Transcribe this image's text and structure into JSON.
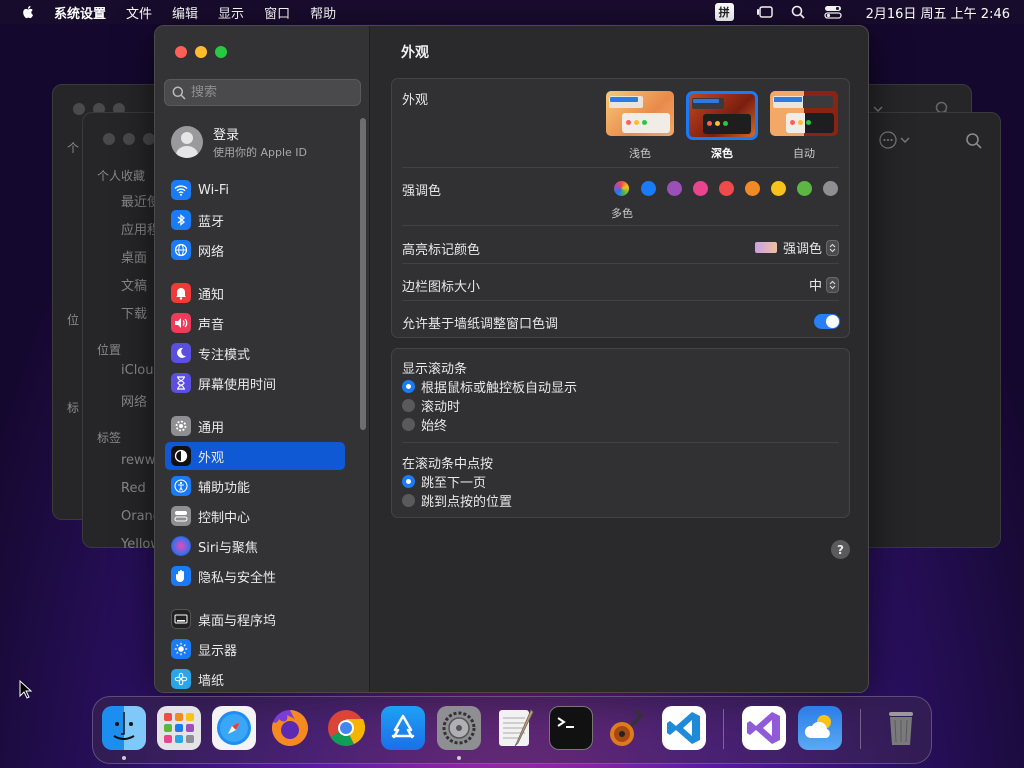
{
  "menubar": {
    "app": "系统设置",
    "items": [
      "文件",
      "编辑",
      "显示",
      "窗口",
      "帮助"
    ],
    "ime": "拼",
    "clock": "2月16日 周五 上午 2:46"
  },
  "finder": {
    "groups": [
      "个人收藏",
      "位置",
      "标签"
    ],
    "favorites": [
      "最近使",
      "应用程",
      "桌面",
      "文稿",
      "下载"
    ],
    "locations": [
      "iClou",
      "网络"
    ],
    "tags": [
      "rewwr",
      "Red",
      "Orang",
      "Yellow"
    ],
    "left_labels": [
      "个",
      "位",
      "标"
    ]
  },
  "sidebar": {
    "search_placeholder": "搜索",
    "login_title": "登录",
    "login_sub": "使用你的 Apple ID",
    "items": [
      {
        "label": "Wi-Fi",
        "icon": "wifi-icon",
        "color": "#1a7bf6"
      },
      {
        "label": "蓝牙",
        "icon": "bluetooth-icon",
        "color": "#1a7bf6"
      },
      {
        "label": "网络",
        "icon": "globe-icon",
        "color": "#1a7bf6"
      },
      {
        "label": "通知",
        "icon": "bell-icon",
        "color": "#ee3b37"
      },
      {
        "label": "声音",
        "icon": "speaker-icon",
        "color": "#ee3b5a"
      },
      {
        "label": "专注模式",
        "icon": "moon-icon",
        "color": "#5b4fe0"
      },
      {
        "label": "屏幕使用时间",
        "icon": "hourglass-icon",
        "color": "#5b4fe0"
      },
      {
        "label": "通用",
        "icon": "gear-icon",
        "color": "#8e8e93"
      },
      {
        "label": "外观",
        "icon": "appearance-icon",
        "color": "#111111"
      },
      {
        "label": "辅助功能",
        "icon": "accessibility-icon",
        "color": "#1a7bf6"
      },
      {
        "label": "控制中心",
        "icon": "control-center-icon",
        "color": "#8e8e93"
      },
      {
        "label": "Siri与聚焦",
        "icon": "siri-icon",
        "color": "#7a3ed6"
      },
      {
        "label": "隐私与安全性",
        "icon": "hand-icon",
        "color": "#1a7bf6"
      },
      {
        "label": "桌面与程序坞",
        "icon": "dock-icon",
        "color": "#222222"
      },
      {
        "label": "显示器",
        "icon": "sun-icon",
        "color": "#1a7bf6"
      },
      {
        "label": "墙纸",
        "icon": "flower-icon",
        "color": "#2aa6e8"
      }
    ]
  },
  "main": {
    "title": "外观",
    "appearance_label": "外观",
    "themes": [
      "浅色",
      "深色",
      "自动"
    ],
    "selected_theme": "深色",
    "accent_label": "强调色",
    "accent_multi": "多色",
    "accent_colors": [
      "#1a7bf6",
      "#9b4fb8",
      "#e9448e",
      "#ee4b4b",
      "#f08a24",
      "#f6c31a",
      "#5db544",
      "#8e8e93"
    ],
    "highlight_label": "高亮标记颜色",
    "highlight_value": "强调色",
    "sidebar_size_label": "边栏图标大小",
    "sidebar_size_value": "中",
    "tint_label": "允许基于墙纸调整窗口色调",
    "scroll_title": "显示滚动条",
    "scroll_options": [
      "根据鼠标或触控板自动显示",
      "滚动时",
      "始终"
    ],
    "click_title": "在滚动条中点按",
    "click_options": [
      "跳至下一页",
      "跳到点按的位置"
    ],
    "help": "?"
  },
  "dock": {
    "apps": [
      "finder-icon",
      "launchpad-icon",
      "safari-icon",
      "firefox-icon",
      "chrome-icon",
      "app-store-icon",
      "system-settings-icon",
      "textedit-icon",
      "terminal-icon",
      "garageband-icon",
      "vscode-icon",
      "visual-studio-icon",
      "weather-icon",
      "trash-icon"
    ]
  }
}
